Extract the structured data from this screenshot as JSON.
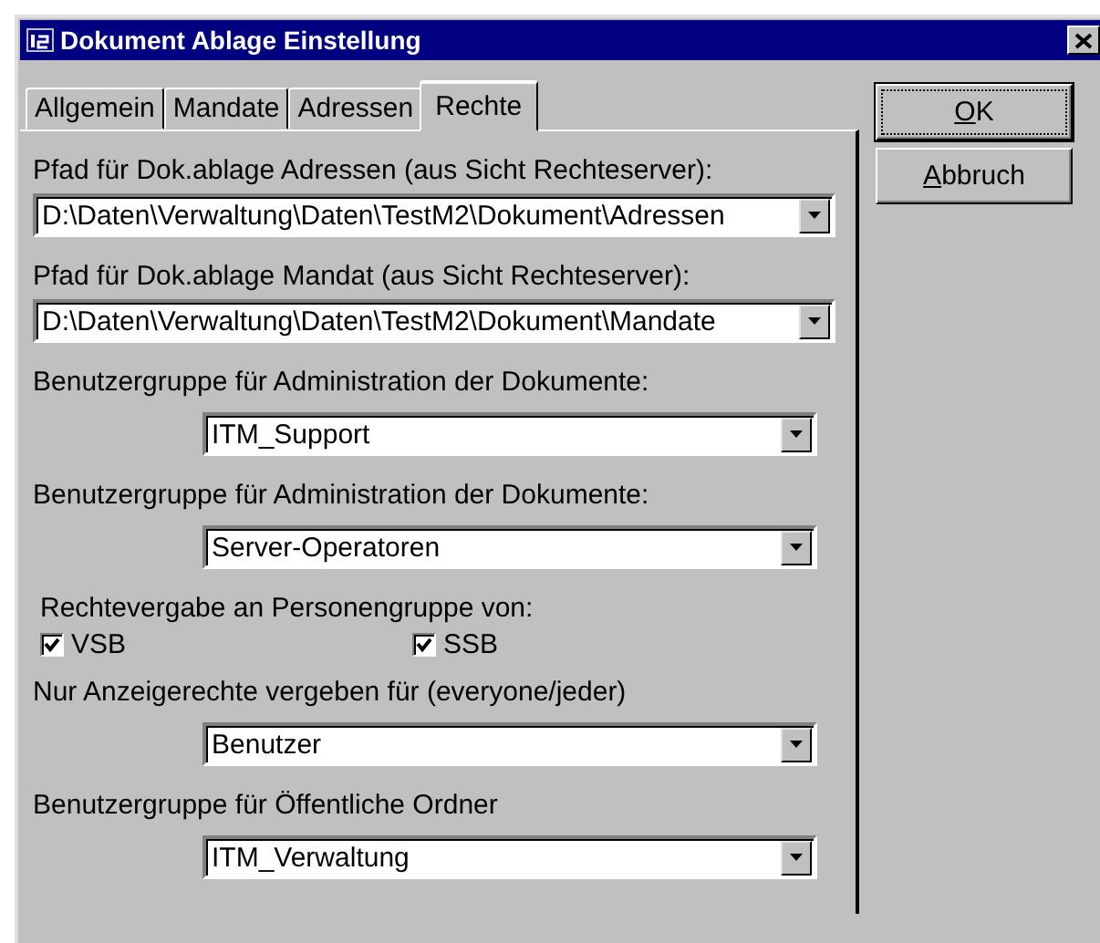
{
  "window": {
    "title": "Dokument Ablage Einstellung"
  },
  "tabs": [
    {
      "label": "Allgemein",
      "selected": false
    },
    {
      "label": "Mandate",
      "selected": false
    },
    {
      "label": "Adressen",
      "selected": false
    },
    {
      "label": "Rechte",
      "selected": true
    }
  ],
  "fields": [
    {
      "kind": "combo",
      "label": "Pfad für Dok.ablage Adressen (aus Sicht Rechteserver):",
      "value": "D:\\Daten\\Verwaltung\\Daten\\TestM2\\Dokument\\Adressen",
      "wide": true
    },
    {
      "kind": "combo",
      "label": "Pfad für Dok.ablage Mandat (aus Sicht Rechteserver):",
      "value": "D:\\Daten\\Verwaltung\\Daten\\TestM2\\Dokument\\Mandate",
      "wide": true
    },
    {
      "kind": "combo",
      "label": "Benutzergruppe für Administration der Dokumente:",
      "value": "ITM_Support",
      "wide": false
    },
    {
      "kind": "combo",
      "label": "Benutzergruppe für Administration der Dokumente:",
      "value": "Server-Operatoren",
      "wide": false
    },
    {
      "kind": "checks",
      "label": "Rechtevergabe an Personengruppe von:",
      "options": [
        {
          "label": "VSB",
          "checked": true
        },
        {
          "label": "SSB",
          "checked": true
        }
      ]
    },
    {
      "kind": "combo",
      "label": "Nur Anzeigerechte vergeben für (everyone/jeder)",
      "value": "Benutzer",
      "wide": false
    },
    {
      "kind": "combo",
      "label": "Benutzergruppe für Öffentliche Ordner",
      "value": "ITM_Verwaltung",
      "wide": false
    }
  ],
  "buttons": [
    {
      "mnemonic": "O",
      "rest": "K",
      "default": true
    },
    {
      "mnemonic": "A",
      "rest": "bbruch",
      "default": false
    }
  ]
}
